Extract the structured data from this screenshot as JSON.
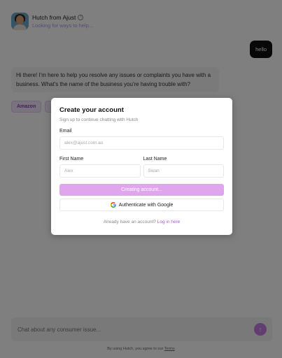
{
  "header": {
    "title": "Hutch from Ajust",
    "status": "Looking for ways to help..."
  },
  "chat": {
    "user_message": "hello",
    "bot_message": "Hi there! I'm here to help you resolve any issues or complaints you have with a business. What's the name of the business you're having trouble with?",
    "suggestions": [
      "Amazon",
      ""
    ]
  },
  "composer": {
    "placeholder": "Chat about any consumer issue..."
  },
  "footer": {
    "text": "By using Hutch, you agree to our",
    "terms_link": "Terms"
  },
  "modal": {
    "title": "Create your account",
    "subtitle": "Sign up to continue chatting with Hutch",
    "email_label": "Email",
    "email_placeholder": "alex@ajust.com.au",
    "first_name_label": "First Name",
    "first_name_placeholder": "Alex",
    "last_name_label": "Last Name",
    "last_name_placeholder": "Swan",
    "create_button": "Creating account...",
    "google_button": "Authenticate with Google",
    "login_prompt": "Already have an account?",
    "login_link": "Log in here"
  },
  "colors": {
    "accent": "#c47de0",
    "accent_light": "#dfa6ee",
    "link": "#a95cce",
    "overlay": "rgba(0,0,0,0.5)"
  }
}
